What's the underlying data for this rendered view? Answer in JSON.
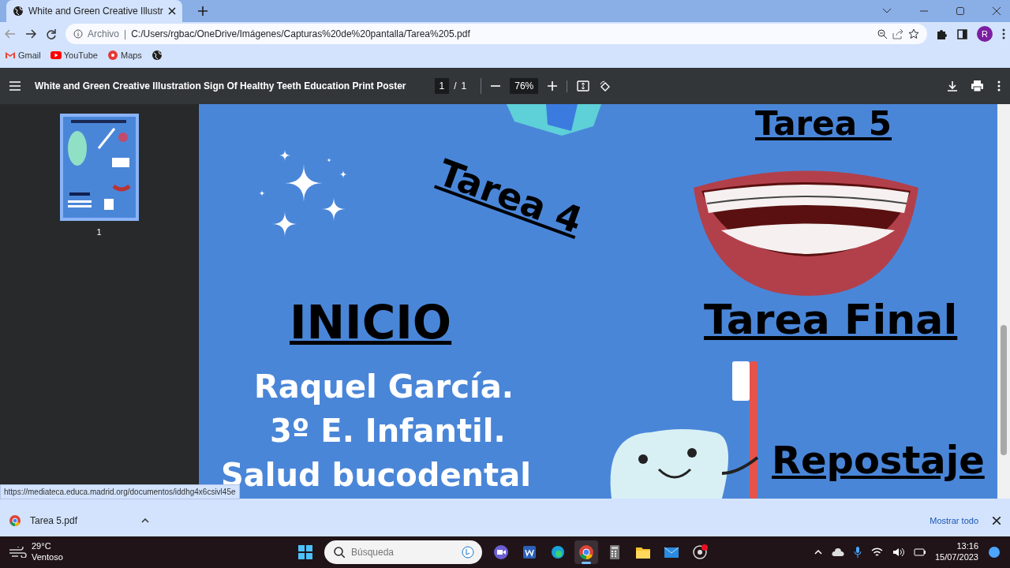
{
  "browser": {
    "tabs": [
      {
        "title": "White and Green Creative Illustr",
        "selected": true
      }
    ],
    "address": {
      "scheme": "Archivo",
      "separator": "|",
      "url": "C:/Users/rgbac/OneDrive/Imágenes/Capturas%20de%20pantalla/Tarea%205.pdf"
    },
    "bookmarks": [
      {
        "label": "Gmail",
        "kind": "gmail"
      },
      {
        "label": "YouTube",
        "kind": "youtube"
      },
      {
        "label": "Maps",
        "kind": "maps"
      }
    ],
    "profile_initial": "R"
  },
  "pdf_viewer": {
    "title": "White and Green Creative Illustration Sign Of Healthy Teeth Education Print Poster",
    "page": "1",
    "separator": "/",
    "page_total": "1",
    "zoom": "76%",
    "thumbnails": [
      {
        "label": "1",
        "selected": true
      }
    ]
  },
  "poster": {
    "texts": [
      {
        "text": "Tarea 5",
        "kind": "task"
      },
      {
        "text": "Tarea 4",
        "kind": "task"
      },
      {
        "text": "INICIO",
        "kind": "heading"
      },
      {
        "text": "Tarea Final",
        "kind": "task"
      },
      {
        "text": "Raquel García.",
        "kind": "author"
      },
      {
        "text": "3º E. Infantil.",
        "kind": "author"
      },
      {
        "text": "Salud bucodental",
        "kind": "author"
      },
      {
        "text": "Repostaje",
        "kind": "task"
      }
    ]
  },
  "status_url": "https://mediateca.educa.madrid.org/documentos/iddhg4x6csivl45e",
  "downloads": {
    "items": [
      {
        "name": "Tarea 5.pdf"
      }
    ],
    "show_all": "Mostrar todo"
  },
  "taskbar": {
    "weather": {
      "temp": "29°C",
      "condition": "Ventoso"
    },
    "search_placeholder": "Búsqueda",
    "apps": [
      {
        "kind": "windows",
        "active": false
      },
      {
        "kind": "meet",
        "active": false
      },
      {
        "kind": "word",
        "active": false
      },
      {
        "kind": "edge",
        "active": false
      },
      {
        "kind": "chrome",
        "active": true
      },
      {
        "kind": "calculator",
        "active": false
      },
      {
        "kind": "folder",
        "active": false
      },
      {
        "kind": "mail",
        "active": false
      },
      {
        "kind": "obs",
        "active": false
      }
    ],
    "time": "13:16",
    "date": "15/07/2023"
  }
}
